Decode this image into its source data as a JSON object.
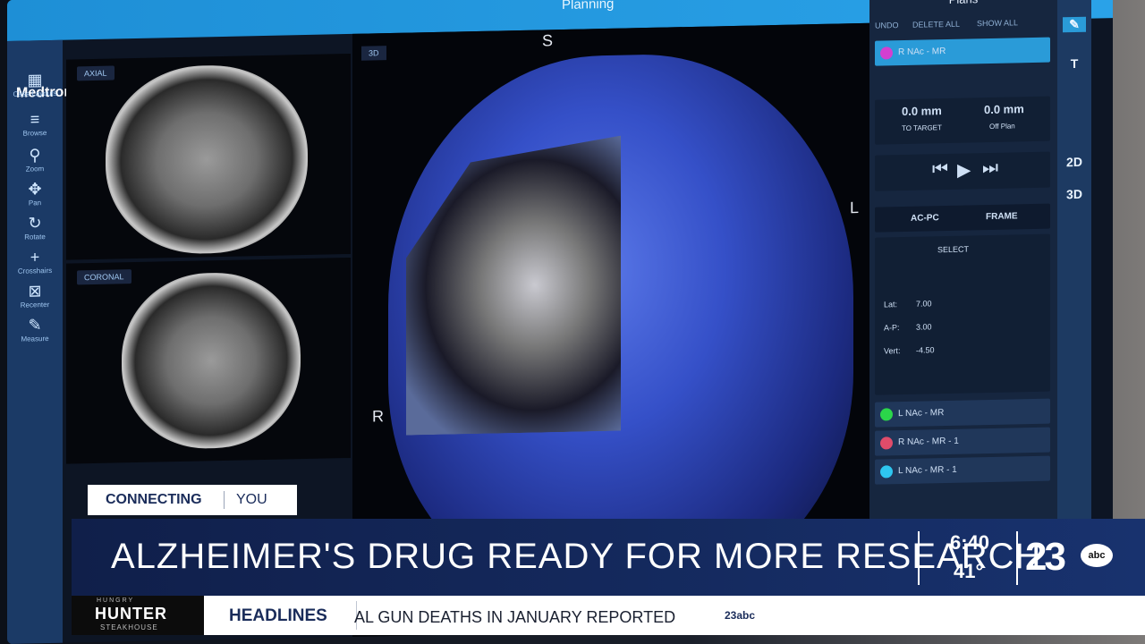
{
  "screen": {
    "title": "Planning",
    "brand": "Medtronic",
    "nav": [
      "Case Layouts",
      "Browse",
      "Zoom",
      "Pan",
      "Rotate",
      "Crosshairs",
      "Recenter",
      "Measure"
    ],
    "views": {
      "axial": "AXIAL",
      "coronal": "CORONAL",
      "v3d": "3D"
    },
    "orientation": {
      "superior": "S",
      "left": "L",
      "right": "R"
    },
    "plans": {
      "title": "Plans",
      "undo": "UNDO",
      "delete_all": "DELETE ALL",
      "show_all": "SHOW ALL",
      "active": "R NAc - MR",
      "to_target_value": "0.0 mm",
      "to_target_label": "TO TARGET",
      "off_plan_value": "0.0 mm",
      "off_plan_label": "Off Plan",
      "tab_acpc": "AC-PC",
      "tab_frame": "FRAME",
      "select": "SELECT",
      "lat": "7.00",
      "ap": "3.00",
      "vert": "-4.50",
      "items": [
        {
          "name": "L NAc - MR",
          "color": "#2bd64a"
        },
        {
          "name": "R NAc - MR - 1",
          "color": "#e04c6a"
        },
        {
          "name": "L NAc - MR - 1",
          "color": "#2ec6f0"
        }
      ]
    },
    "tools": [
      "T",
      "2D",
      "3D"
    ]
  },
  "broadcast": {
    "badge_left": "CONNECTING",
    "badge_right": "YOU",
    "headline": "ALZHEIMER'S DRUG READY FOR MORE RESEARCH",
    "time": "6:40",
    "temp": "41°",
    "station_logo": "23",
    "network_logo": "abc",
    "sponsor": {
      "top": "HUNGRY",
      "main": "HUNTER",
      "bottom": "STEAKHOUSE"
    },
    "ticker_label": "HEADLINES",
    "ticker_text": "AL GUN DEATHS IN JANUARY REPORTED",
    "ticker_logo": "23abc"
  }
}
